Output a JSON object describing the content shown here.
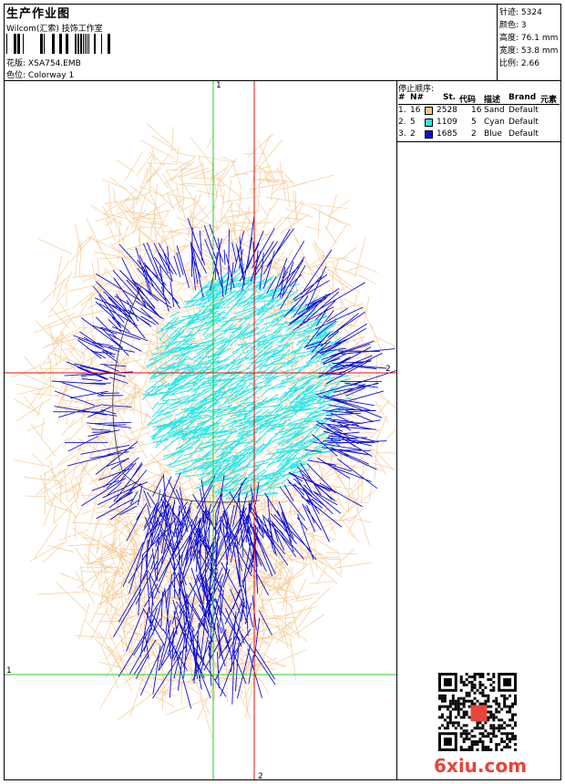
{
  "header": {
    "title": "生产作业图",
    "subtitle": "Wilcom(汇索) 技饰工作室",
    "design_label": "花版:",
    "design_value": "XSA754.EMB",
    "colorway_label": "色位:",
    "colorway_value": "Colorway 1"
  },
  "stats": [
    {
      "label": "针迹:",
      "value": "5324"
    },
    {
      "label": "颜色:",
      "value": "3"
    },
    {
      "label": "高度:",
      "value": "76.1 mm"
    },
    {
      "label": "宽度:",
      "value": "53.8 mm"
    },
    {
      "label": "比例:",
      "value": "2.66"
    }
  ],
  "stop_sequence": {
    "title": "停止顺序:",
    "headers": {
      "idx": "#",
      "n": "N#",
      "st": "St.",
      "code": "代码",
      "desc": "描述",
      "brand": "Brand",
      "elem": "元素"
    },
    "rows": [
      {
        "idx": "1.",
        "n": "16",
        "color": "#F5C58A",
        "st": "2528",
        "code": "16",
        "desc": "Sand",
        "brand": "Default"
      },
      {
        "idx": "2.",
        "n": "5",
        "color": "#2EE6E6",
        "st": "1109",
        "code": "5",
        "desc": "Cyan",
        "brand": "Default"
      },
      {
        "idx": "3.",
        "n": "2",
        "color": "#1010D0",
        "st": "1685",
        "code": "2",
        "desc": "Blue",
        "brand": "Default"
      }
    ]
  },
  "canvas": {
    "axis_labels": {
      "green_top": "1",
      "green_left": "1",
      "red_right": "2",
      "red_bottom": "2"
    },
    "colors": {
      "sand": "#F5C58A",
      "cyan": "#2EE6E6",
      "blue": "#1010D0",
      "green_axis": "#22CC22",
      "red_axis": "#DD1111"
    }
  },
  "watermark": {
    "text": "6xiu.com"
  }
}
